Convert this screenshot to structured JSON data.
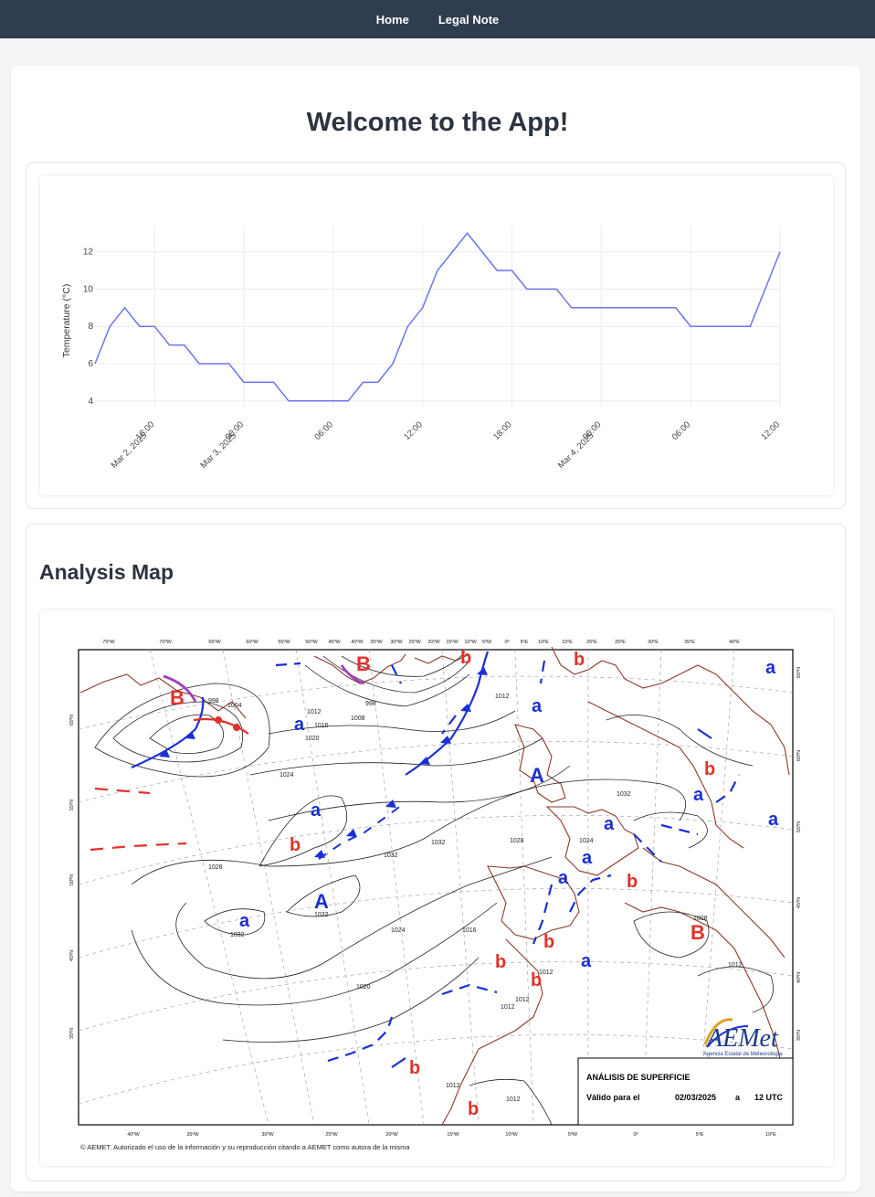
{
  "nav": {
    "items": [
      {
        "label": "Home"
      },
      {
        "label": "Legal Note"
      }
    ]
  },
  "page": {
    "title": "Welcome to the App!"
  },
  "chart_data": {
    "type": "line",
    "title": "",
    "xlabel": "",
    "ylabel": "Temperature (°C)",
    "ylim": [
      3.6,
      13.4
    ],
    "yticks": [
      4,
      6,
      8,
      10,
      12
    ],
    "grid": true,
    "color": "#6b73f2",
    "xticks": [
      {
        "hour": 18,
        "line1": "18:00",
        "line2": "Mar 2, 2025"
      },
      {
        "hour": 24,
        "line1": "00:00",
        "line2": "Mar 3, 2025"
      },
      {
        "hour": 30,
        "line1": "06:00",
        "line2": ""
      },
      {
        "hour": 36,
        "line1": "12:00",
        "line2": ""
      },
      {
        "hour": 42,
        "line1": "18:00",
        "line2": ""
      },
      {
        "hour": 48,
        "line1": "00:00",
        "line2": "Mar 4, 2025"
      },
      {
        "hour": 54,
        "line1": "06:00",
        "line2": ""
      },
      {
        "hour": 60,
        "line1": "12:00",
        "line2": ""
      }
    ],
    "series": [
      {
        "x": [
          14,
          15,
          16,
          17,
          18,
          19,
          20,
          21,
          22,
          23,
          24,
          25,
          26,
          27,
          28,
          29,
          30,
          31,
          32,
          33,
          34,
          35,
          36,
          37,
          38,
          39,
          40,
          41,
          42,
          43,
          44,
          45,
          46,
          47,
          48,
          49,
          50,
          51,
          52,
          53,
          54,
          55,
          56,
          57,
          58,
          59,
          60
        ],
        "values": [
          6,
          8,
          9,
          8,
          8,
          7,
          7,
          6,
          6,
          6,
          5,
          5,
          5,
          4,
          4,
          4,
          4,
          4,
          5,
          5,
          6,
          8,
          9,
          11,
          12,
          13,
          12,
          11,
          11,
          10,
          10,
          10,
          9,
          9,
          9,
          9,
          9,
          9,
          9,
          9,
          8,
          8,
          8,
          8,
          8,
          10,
          12
        ]
      }
    ]
  },
  "analysis": {
    "title": "Analysis Map",
    "lon_labels_top": [
      "75ºW",
      "70ºW",
      "65ºW",
      "60ºW",
      "55ºW",
      "50ºW",
      "45ºW",
      "40ºW",
      "35ºW",
      "30ºW",
      "25ºW",
      "20ºW",
      "15ºW",
      "10ºW",
      "5ºW",
      "0º",
      "5ºE",
      "10ºE",
      "15ºE",
      "20ºE",
      "25ºE",
      "30ºE",
      "35ºE",
      "40ºE"
    ],
    "lon_labels_bottom": [
      "40ºW",
      "35ºW",
      "30ºW",
      "25ºW",
      "20ºW",
      "15ºW",
      "10ºW",
      "5ºW",
      "0º",
      "5ºE",
      "10ºE"
    ],
    "lat_labels_left": [
      "65ºN",
      "55ºN",
      "50ºN",
      "45ºN",
      "35ºN"
    ],
    "lat_labels_right": [
      "65ºN",
      "60ºN",
      "55ºN",
      "45ºN",
      "40ºN",
      "35ºN"
    ],
    "isobars": [
      "998",
      "1004",
      "1008",
      "1012",
      "1016",
      "1020",
      "1024",
      "1028",
      "1032"
    ],
    "lows_label": "b",
    "highs_label": "a",
    "big_low": "B",
    "big_high": "A",
    "panel_title": "ANÁLISIS DE SUPERFICIE",
    "valid_label": "Válido para el",
    "valid_date": "02/03/2025",
    "valid_sep": "a",
    "valid_time": "12 UTC",
    "logo_text": "AEMet",
    "logo_sub": "Agencia Estatal de Meteorología",
    "copyright": "© AEMET. Autorizado el uso de la información y su reproducción citando a AEMET como autora de la misma",
    "colors": {
      "low": "#e0322a",
      "high": "#1a2fd6",
      "front_cold": "#1a2fd6",
      "front_warm": "#e0322a",
      "occluded": "#a040c0",
      "coast": "#8b3a2a"
    }
  }
}
